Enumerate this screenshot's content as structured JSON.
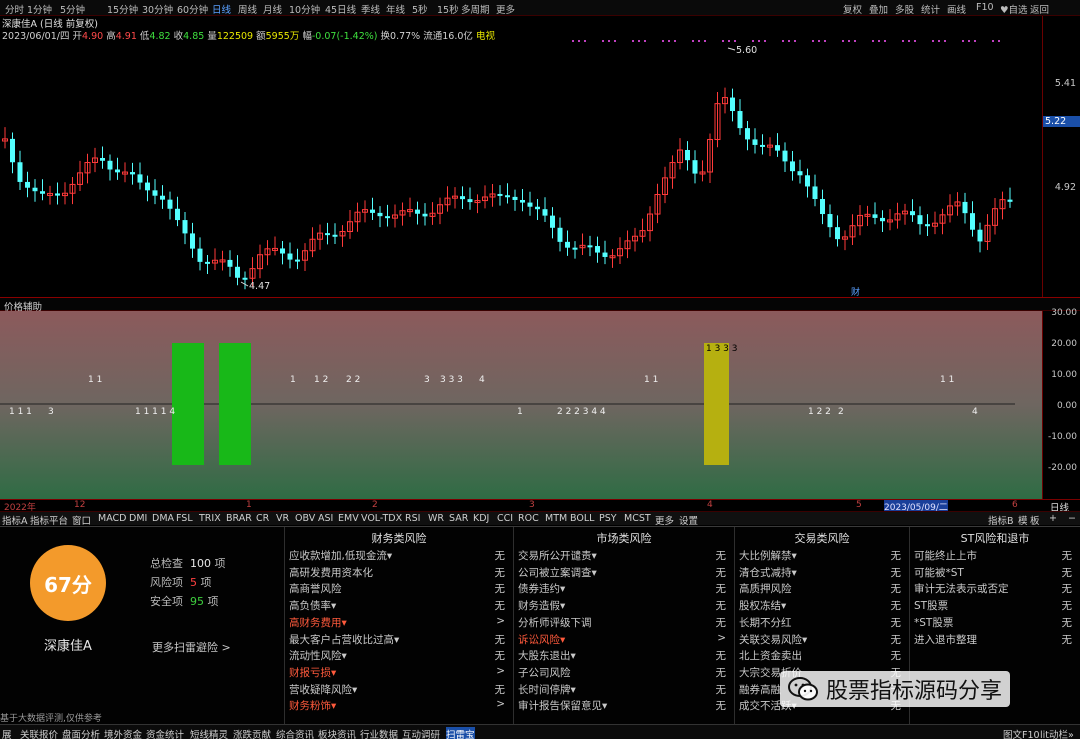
{
  "toolbar": {
    "periods": [
      "分时",
      "1分钟",
      "5分钟",
      "15分钟",
      "30分钟",
      "60分钟",
      "日线",
      "周线",
      "月线",
      "10分钟",
      "45日线",
      "季线",
      "年线",
      "5秒",
      "15秒",
      "多周期",
      "更多"
    ],
    "active_period": "日线",
    "right": [
      "复权",
      "叠加",
      "多股",
      "统计",
      "画线",
      "F10",
      "♥自选",
      "返回"
    ]
  },
  "stock": {
    "name": "深康佳A",
    "mode": "(日线 前复权)",
    "date": "2023/06/01/四",
    "open_label": "开",
    "open": "4.90",
    "high_label": "高",
    "high": "4.91",
    "low_label": "低",
    "low": "4.82",
    "close_label": "收",
    "close": "4.85",
    "vol_label": "量",
    "volume": "122509",
    "amt_label": "额",
    "amount": "5955万",
    "chg_label": "幅",
    "change": "-0.07(-1.42%)",
    "turn_label": "换",
    "turnover": "0.77%",
    "float_label": "流通",
    "float_cap": "16.0亿",
    "tag": "电视"
  },
  "price_axis": {
    "labels": [
      "5.41",
      "5.22",
      "4.92"
    ],
    "current": "5.22"
  },
  "annotations": {
    "max": "5.60",
    "min": "4.47",
    "cai": "财"
  },
  "aux": {
    "title": "价格辅助",
    "axis": [
      "30.00",
      "20.00",
      "10.00",
      "0.00",
      "-10.00",
      "-20.00"
    ],
    "numbers_row1": [
      "1 1",
      "1",
      "1 2",
      "2 2",
      "3",
      "3 3 3",
      "4",
      "1 1",
      "1 1"
    ],
    "numbers_row2": [
      "1 1 1",
      "3",
      "1 1 1 1 4",
      "1",
      "2 2 2 3 4 4",
      "1 2 2",
      "2",
      "4"
    ],
    "yellow_label": "1 3 3 3"
  },
  "dates": [
    "2022年",
    "12",
    "1",
    "2",
    "3",
    "4",
    "5",
    "2023/05/09/二",
    "6"
  ],
  "date_right": "日线",
  "ind_tabs": [
    "指标A",
    "指标平台",
    "窗口",
    "MACD",
    "DMI",
    "DMA",
    "FSL",
    "TRIX",
    "BRAR",
    "CR",
    "VR",
    "OBV",
    "ASI",
    "EMV",
    "VOL-TDX",
    "RSI",
    "WR",
    "SAR",
    "KDJ",
    "CCI",
    "ROC",
    "MTM",
    "BOLL",
    "PSY",
    "MCST",
    "更多",
    "设置"
  ],
  "ind_tabs_right": [
    "指标B",
    "模",
    "板",
    "+",
    "−"
  ],
  "risk": {
    "score": "67分",
    "total_label": "总检查",
    "total": "100",
    "total_unit": "项",
    "risk_label": "风险项",
    "risk": "5",
    "risk_unit": "项",
    "safe_label": "安全项",
    "safe": "95",
    "safe_unit": "项",
    "stock_name": "深康佳A",
    "more_link": "更多扫雷避险 >",
    "disclaimer": "基于大数据评测,仅供参考",
    "colors": {
      "score_bg": "#f39a2b",
      "risk_num": "#ff4040",
      "safe_num": "#3ecf3e",
      "highlight": "#ff5a3c"
    },
    "columns": [
      {
        "title": "财务类风险",
        "items": [
          {
            "name": "应收款增加,低现金流▾",
            "status": "无",
            "hl": false
          },
          {
            "name": "高研发费用资本化",
            "status": "无",
            "hl": false
          },
          {
            "name": "高商誉风险",
            "status": "无",
            "hl": false
          },
          {
            "name": "高负债率▾",
            "status": "无",
            "hl": false
          },
          {
            "name": "高财务费用▾",
            "status": ">",
            "hl": true
          },
          {
            "name": "最大客户占营收比过高▾",
            "status": "无",
            "hl": false
          },
          {
            "name": "流动性风险▾",
            "status": "无",
            "hl": false
          },
          {
            "name": "财报亏损▾",
            "status": ">",
            "hl": true
          },
          {
            "name": "营收疑降风险▾",
            "status": "无",
            "hl": false
          },
          {
            "name": "财务粉饰▾",
            "status": ">",
            "hl": true
          }
        ]
      },
      {
        "title": "市场类风险",
        "items": [
          {
            "name": "交易所公开谴责▾",
            "status": "无",
            "hl": false
          },
          {
            "name": "公司被立案调查▾",
            "status": "无",
            "hl": false
          },
          {
            "name": "债券违约▾",
            "status": "无",
            "hl": false
          },
          {
            "name": "财务造假▾",
            "status": "无",
            "hl": false
          },
          {
            "name": "分析师评级下调",
            "status": "无",
            "hl": false
          },
          {
            "name": "诉讼风险▾",
            "status": ">",
            "hl": true
          },
          {
            "name": "大股东退出▾",
            "status": "无",
            "hl": false
          },
          {
            "name": "子公司风险",
            "status": "无",
            "hl": false
          },
          {
            "name": "长时间停牌▾",
            "status": "无",
            "hl": false
          },
          {
            "name": "审计报告保留意见▾",
            "status": "无",
            "hl": false
          }
        ]
      },
      {
        "title": "交易类风险",
        "items": [
          {
            "name": "大比例解禁▾",
            "status": "无",
            "hl": false
          },
          {
            "name": "清仓式减持▾",
            "status": "无",
            "hl": false
          },
          {
            "name": "高质押风险",
            "status": "无",
            "hl": false
          },
          {
            "name": "股权冻结▾",
            "status": "无",
            "hl": false
          },
          {
            "name": "长期不分红",
            "status": "无",
            "hl": false
          },
          {
            "name": "关联交易风险▾",
            "status": "无",
            "hl": false
          },
          {
            "name": "北上资金卖出",
            "status": "无",
            "hl": false
          },
          {
            "name": "大宗交易折价",
            "status": "无",
            "hl": false
          },
          {
            "name": "融券高融",
            "status": "无",
            "hl": false
          },
          {
            "name": "成交不活跃▾",
            "status": "无",
            "hl": false
          }
        ]
      },
      {
        "title": "ST风险和退市",
        "items": [
          {
            "name": "可能终止上市",
            "status": "无",
            "hl": false
          },
          {
            "name": "可能被*ST",
            "status": "无",
            "hl": false
          },
          {
            "name": "审计无法表示或否定",
            "status": "无",
            "hl": false
          },
          {
            "name": "ST股票",
            "status": "无",
            "hl": false
          },
          {
            "name": "*ST股票",
            "status": "无",
            "hl": false
          },
          {
            "name": "进入退市整理",
            "status": "无",
            "hl": false
          }
        ]
      }
    ]
  },
  "bottom_tabs": [
    "展",
    "关联报价",
    "盘面分析",
    "境外资金",
    "资金统计",
    "短线精灵",
    "涨跌贡献",
    "综合资讯",
    "板块资讯",
    "行业数据",
    "互动调研",
    "扫雷宝"
  ],
  "bottom_active": "扫雷宝",
  "bottom_right": [
    "图文F10",
    "lit动栏»"
  ],
  "watermark": "股票指标源码分享"
}
